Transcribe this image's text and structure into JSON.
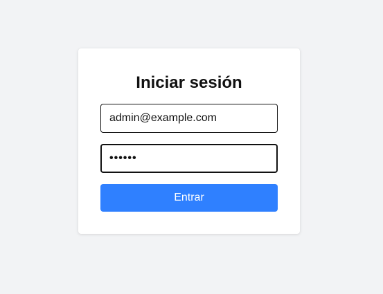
{
  "login": {
    "title": "Iniciar sesión",
    "email_value": "admin@example.com",
    "password_value": "••••••",
    "submit_label": "Entrar"
  },
  "colors": {
    "page_background": "#f2f3f5",
    "card_background": "#ffffff",
    "button_background": "#2f80ff",
    "button_text": "#ffffff"
  }
}
